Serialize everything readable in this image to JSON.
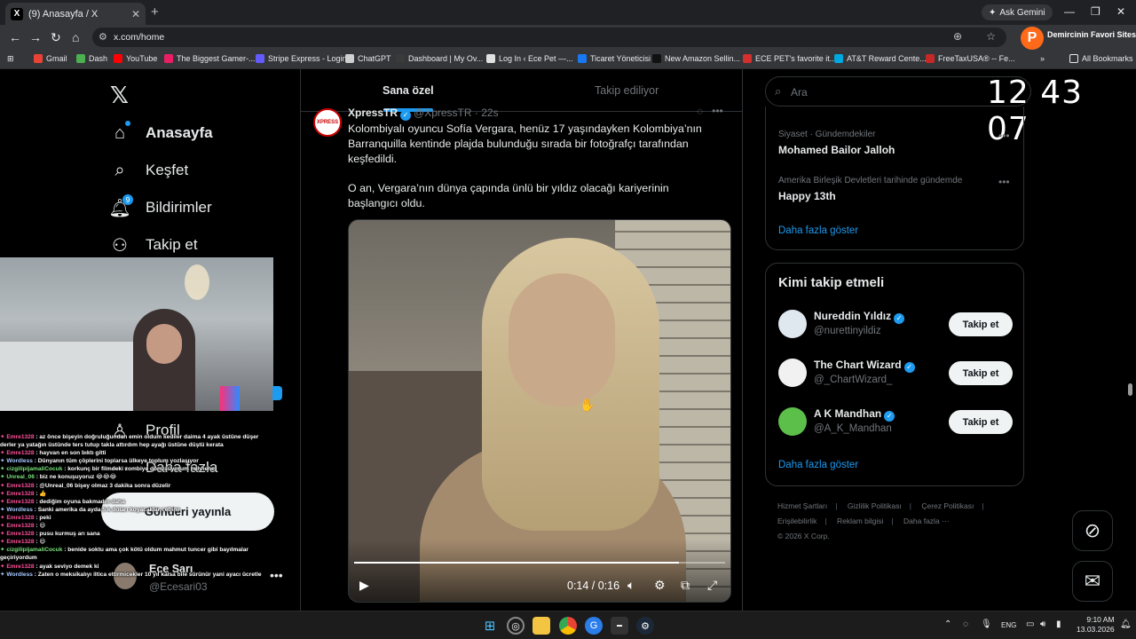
{
  "browser": {
    "tab_title": "(9) Anasayfa / X",
    "tab_favicon": "X",
    "url": "x.com/home",
    "gemini_label": "Ask Gemini",
    "extension_label": "Demircinin Favori Sitesi",
    "bookmarks": [
      "Gmail",
      "Dash",
      "YouTube",
      "The Biggest Gamer-...",
      "Stripe Express - Login",
      "ChatGPT",
      "Dashboard | My Ov...",
      "Log In ‹ Ece Pet —...",
      "Ticaret Yöneticisi",
      "New Amazon Sellin...",
      "ECE PET's favorite it...",
      "AT&T Reward Cente...",
      "FreeTaxUSA® -- Fe...",
      "All Bookmarks"
    ]
  },
  "nav": {
    "home": "Anasayfa",
    "explore": "Keşfet",
    "notifications": "Bildirimler",
    "notifications_badge": "9",
    "follow": "Takip et",
    "profile": "Profil",
    "more": "Daha fazla",
    "post_button": "Gönderi yayınla"
  },
  "account": {
    "name": "Ece Sarı",
    "handle": "@Ecesari03"
  },
  "timeline": {
    "tab_for_you": "Sana özel",
    "tab_following": "Takip ediliyor"
  },
  "tweet": {
    "author": "XpressTR",
    "handle": "@XpressTR",
    "time": "22s",
    "avatar_text": "XPRESS",
    "text1": "Kolombiyalı oyuncu Sofía Vergara, henüz 17 yaşındayken Kolombiya’nın Barranquilla kentinde plajda bulunduğu sırada bir fotoğrafçı tarafından keşfedildi.",
    "text2": "O an, Vergara’nın dünya çapında ünlü bir yıldız olacağı kariyerinin başlangıcı oldu.",
    "video_time": "0:14 / 0:16",
    "video_progress": 0.875
  },
  "search": {
    "placeholder": "Ara"
  },
  "clock": "12 43 07",
  "trends": [
    {
      "category": "Siyaset · Gündemdekiler",
      "name": "Mohamed Bailor Jalloh"
    },
    {
      "category": "Amerika Birleşik Devletleri tarihinde gündemde",
      "name": "Happy 13th"
    }
  ],
  "trends_show_more": "Daha fazla göster",
  "who_to_follow": {
    "title": "Kimi takip etmeli",
    "users": [
      {
        "name": "Nureddin Yıldız",
        "handle": "@nurettinyildiz",
        "button": "Takip et"
      },
      {
        "name": "The Chart Wizard",
        "handle": "@_ChartWizard_",
        "button": "Takip et"
      },
      {
        "name": "A K Mandhan",
        "handle": "@A_K_Mandhan",
        "button": "Takip et"
      }
    ],
    "show_more": "Daha fazla göster"
  },
  "footer": {
    "terms": "Hizmet Şartları",
    "privacy": "Gizlilik Politikası",
    "cookies": "Çerez Politikası",
    "accessibility": "Erişilebilirlik",
    "ads": "Reklam bilgisi",
    "more": "Daha fazla ···",
    "copyright": "© 2026 X Corp."
  },
  "chat": [
    {
      "user": "Emre1328",
      "msg": ": az önce bişeyin doğruluğundan emin oldum kediler daima 4 ayak üstüne düşer",
      "cls": "u1"
    },
    {
      "user": "",
      "msg": "derler ya yatağın üstünde ters tutup takla attırdım hep ayağı üstüne düştü kerata",
      "cls": "u1"
    },
    {
      "user": "Emre1328",
      "msg": ": hayvan en son bıktı gitti",
      "cls": "u1"
    },
    {
      "user": "Wordless",
      "msg": ": Dünyanın tüm çöplerini toplarsa ülkeye toplum yozlaşıyor",
      "cls": "u2"
    },
    {
      "user": "cizgilipijamaliCocuk",
      "msg": ": korkunç bir filmdeki zombiye dönüşüyorum hehhehe",
      "cls": "u3"
    },
    {
      "user": "Unreal_06",
      "msg": ": biz ne konuşuyoruz 😂😂😂",
      "cls": "u3"
    },
    {
      "user": "Emre1328",
      "msg": ": @Unreal_06 bişey olmaz 3 dakika sonra düzelir",
      "cls": "u1"
    },
    {
      "user": "Emre1328",
      "msg": ": 👍",
      "cls": "u1"
    },
    {
      "user": "Emre1328",
      "msg": ": dediğim oyuna bakmadın daha",
      "cls": "u1"
    },
    {
      "user": "Wordless",
      "msg": ": Sanki amerika da ayda 5 k doları koyacaklar cebine",
      "cls": "u2"
    },
    {
      "user": "Emre1328",
      "msg": ": peki",
      "cls": "u1"
    },
    {
      "user": "Emre1328",
      "msg": ": 😃",
      "cls": "u1"
    },
    {
      "user": "Emre1328",
      "msg": ": pusu kurmuş arı sana",
      "cls": "u1"
    },
    {
      "user": "Emre1328",
      "msg": ": 😃",
      "cls": "u1"
    },
    {
      "user": "cizgilipijamaliCocuk",
      "msg": ": benide soktu ama çok kötü oldum mahmut tuncer gibi bayılmalar",
      "cls": "u3"
    },
    {
      "user": "",
      "msg": "geçiriyordum",
      "cls": "u3"
    },
    {
      "user": "Emre1328",
      "msg": ": ayak seviyo demek ki",
      "cls": "u1"
    },
    {
      "user": "Wordless",
      "msg": ": Zaten o meksikalıyı iltica ettirmicekler 10 yıl kalsa bile sürünür yani ayacı ücretle",
      "cls": "u2"
    }
  ],
  "taskbar": {
    "lang": "ENG",
    "time": "9:10 AM",
    "date": "13.03.2026"
  },
  "colors": {
    "accent": "#1d9bf0",
    "background": "#000000"
  }
}
